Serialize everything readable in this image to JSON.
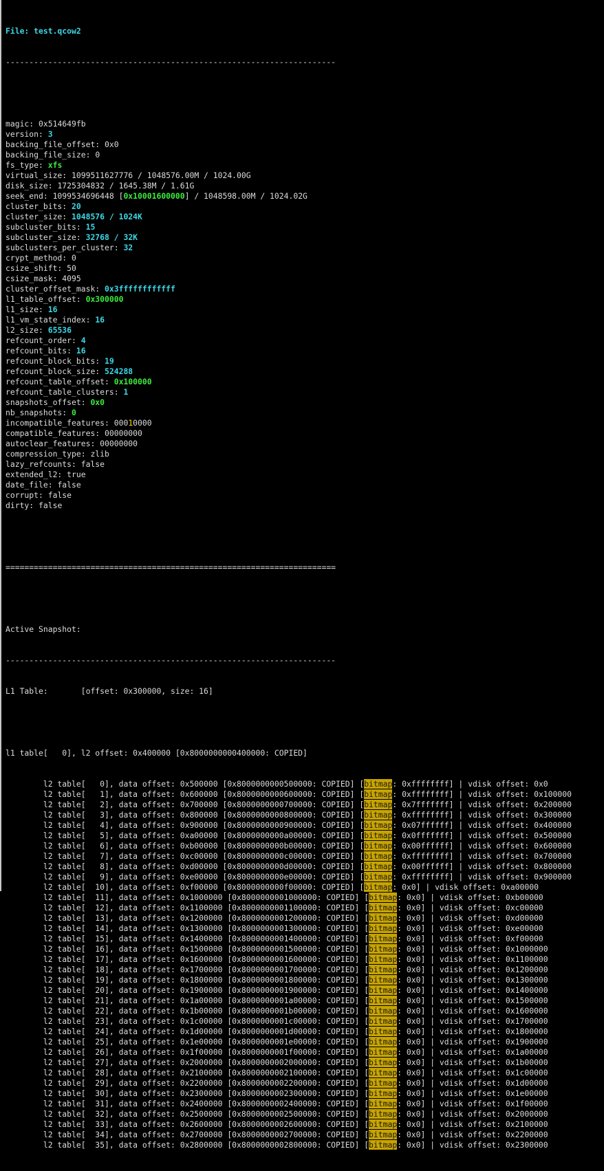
{
  "file_line": "File: test.qcow2",
  "separator_dash": "----------------------------------------------------------------------",
  "separator_eq": "======================================================================",
  "header_fields": [
    {
      "key": "magic",
      "value": "0x514649fb",
      "style": ""
    },
    {
      "key": "version",
      "value": "3",
      "style": "cyan"
    },
    {
      "key": "backing_file_offset",
      "value": "0x0",
      "style": ""
    },
    {
      "key": "backing_file_size",
      "value": "0",
      "style": ""
    },
    {
      "key": "fs_type",
      "value": "xfs",
      "style": "green"
    },
    {
      "key": "virtual_size",
      "value": "1099511627776 / 1048576.00M / 1024.00G",
      "style": ""
    },
    {
      "key": "disk_size",
      "value": "1725304832 / 1645.38M / 1.61G",
      "style": ""
    },
    {
      "key": "seek_end",
      "value": "1099534696448 [0x10001600000] / 1048598.00M / 1024.02G",
      "style": "seek"
    },
    {
      "key": "cluster_bits",
      "value": "20",
      "style": "cyan"
    },
    {
      "key": "cluster_size",
      "value": "1048576 / 1024K",
      "style": "cyan"
    },
    {
      "key": "subcluster_bits",
      "value": "15",
      "style": "cyan"
    },
    {
      "key": "subcluster_size",
      "value": "32768 / 32K",
      "style": "cyan"
    },
    {
      "key": "subclusters_per_cluster",
      "value": "32",
      "style": "cyan"
    },
    {
      "key": "crypt_method",
      "value": "0",
      "style": ""
    },
    {
      "key": "csize_shift",
      "value": "50",
      "style": ""
    },
    {
      "key": "csize_mask",
      "value": "4095",
      "style": ""
    },
    {
      "key": "cluster_offset_mask",
      "value": "0x3ffffffffffff",
      "style": "cyan"
    },
    {
      "key": "l1_table_offset",
      "value": "0x300000",
      "style": "green"
    },
    {
      "key": "l1_size",
      "value": "16",
      "style": "cyan"
    },
    {
      "key": "l1_vm_state_index",
      "value": "16",
      "style": "cyan"
    },
    {
      "key": "l2_size",
      "value": "65536",
      "style": "cyan"
    },
    {
      "key": "refcount_order",
      "value": "4",
      "style": "cyan"
    },
    {
      "key": "refcount_bits",
      "value": "16",
      "style": "cyan"
    },
    {
      "key": "refcount_block_bits",
      "value": "19",
      "style": "cyan"
    },
    {
      "key": "refcount_block_size",
      "value": "524288",
      "style": "cyan"
    },
    {
      "key": "refcount_table_offset",
      "value": "0x100000",
      "style": "green"
    },
    {
      "key": "refcount_table_clusters",
      "value": "1",
      "style": "cyan"
    },
    {
      "key": "snapshots_offset",
      "value": "0x0",
      "style": "green"
    },
    {
      "key": "nb_snapshots",
      "value": "0",
      "style": "green"
    },
    {
      "key": "incompatible_features",
      "value": "00010000",
      "style": "incompat"
    },
    {
      "key": "compatible_features",
      "value": "00000000",
      "style": ""
    },
    {
      "key": "autoclear_features",
      "value": "00000000",
      "style": ""
    },
    {
      "key": "compression_type",
      "value": "zlib",
      "style": ""
    },
    {
      "key": "lazy_refcounts",
      "value": "false",
      "style": ""
    },
    {
      "key": "extended_l2",
      "value": "true",
      "style": ""
    },
    {
      "key": "date_file",
      "value": "false",
      "style": ""
    },
    {
      "key": "corrupt",
      "value": "false",
      "style": ""
    },
    {
      "key": "dirty",
      "value": "false",
      "style": ""
    }
  ],
  "active_snapshot_label": "Active Snapshot:",
  "l1_table_line": "L1 Table:       [offset: 0x300000, size: 16]",
  "l1_entry_line": "l1 table[   0], l2 offset: 0x400000 [0x8000000000400000: COPIED]",
  "l2_entries": [
    {
      "idx": "0",
      "data": "0x500000",
      "raw": "0x8000000000500000",
      "bitmap": "0xffffffff",
      "vdisk": "0x0"
    },
    {
      "idx": "1",
      "data": "0x600000",
      "raw": "0x8000000000600000",
      "bitmap": "0xffffffff",
      "vdisk": "0x100000"
    },
    {
      "idx": "2",
      "data": "0x700000",
      "raw": "0x8000000000700000",
      "bitmap": "0x7fffffff",
      "vdisk": "0x200000"
    },
    {
      "idx": "3",
      "data": "0x800000",
      "raw": "0x8000000000800000",
      "bitmap": "0xffffffff",
      "vdisk": "0x300000"
    },
    {
      "idx": "4",
      "data": "0x900000",
      "raw": "0x8000000000900000",
      "bitmap": "0x07ffffff",
      "vdisk": "0x400000"
    },
    {
      "idx": "5",
      "data": "0xa00000",
      "raw": "0x8000000000a00000",
      "bitmap": "0x0fffffff",
      "vdisk": "0x500000"
    },
    {
      "idx": "6",
      "data": "0xb00000",
      "raw": "0x8000000000b00000",
      "bitmap": "0x00ffffff",
      "vdisk": "0x600000"
    },
    {
      "idx": "7",
      "data": "0xc00000",
      "raw": "0x8000000000c00000",
      "bitmap": "0xffffffff",
      "vdisk": "0x700000"
    },
    {
      "idx": "8",
      "data": "0xd00000",
      "raw": "0x8000000000d00000",
      "bitmap": "0x00ffffff",
      "vdisk": "0x800000"
    },
    {
      "idx": "9",
      "data": "0xe00000",
      "raw": "0x8000000000e00000",
      "bitmap": "0xffffffff",
      "vdisk": "0x900000"
    },
    {
      "idx": "10",
      "data": "0xf00000",
      "raw": "0x8000000000f00000",
      "bitmap": "0x0",
      "vdisk": "0xa00000"
    },
    {
      "idx": "11",
      "data": "0x1000000",
      "raw": "0x8000000001000000",
      "bitmap": "0x0",
      "vdisk": "0xb00000"
    },
    {
      "idx": "12",
      "data": "0x1100000",
      "raw": "0x8000000001100000",
      "bitmap": "0x0",
      "vdisk": "0xc00000"
    },
    {
      "idx": "13",
      "data": "0x1200000",
      "raw": "0x8000000001200000",
      "bitmap": "0x0",
      "vdisk": "0xd00000"
    },
    {
      "idx": "14",
      "data": "0x1300000",
      "raw": "0x8000000001300000",
      "bitmap": "0x0",
      "vdisk": "0xe00000"
    },
    {
      "idx": "15",
      "data": "0x1400000",
      "raw": "0x8000000001400000",
      "bitmap": "0x0",
      "vdisk": "0xf00000"
    },
    {
      "idx": "16",
      "data": "0x1500000",
      "raw": "0x8000000001500000",
      "bitmap": "0x0",
      "vdisk": "0x1000000"
    },
    {
      "idx": "17",
      "data": "0x1600000",
      "raw": "0x8000000001600000",
      "bitmap": "0x0",
      "vdisk": "0x1100000"
    },
    {
      "idx": "18",
      "data": "0x1700000",
      "raw": "0x8000000001700000",
      "bitmap": "0x0",
      "vdisk": "0x1200000"
    },
    {
      "idx": "19",
      "data": "0x1800000",
      "raw": "0x8000000001800000",
      "bitmap": "0x0",
      "vdisk": "0x1300000"
    },
    {
      "idx": "20",
      "data": "0x1900000",
      "raw": "0x8000000001900000",
      "bitmap": "0x0",
      "vdisk": "0x1400000"
    },
    {
      "idx": "21",
      "data": "0x1a00000",
      "raw": "0x8000000001a00000",
      "bitmap": "0x0",
      "vdisk": "0x1500000"
    },
    {
      "idx": "22",
      "data": "0x1b00000",
      "raw": "0x8000000001b00000",
      "bitmap": "0x0",
      "vdisk": "0x1600000"
    },
    {
      "idx": "23",
      "data": "0x1c00000",
      "raw": "0x8000000001c00000",
      "bitmap": "0x0",
      "vdisk": "0x1700000"
    },
    {
      "idx": "24",
      "data": "0x1d00000",
      "raw": "0x8000000001d00000",
      "bitmap": "0x0",
      "vdisk": "0x1800000"
    },
    {
      "idx": "25",
      "data": "0x1e00000",
      "raw": "0x8000000001e00000",
      "bitmap": "0x0",
      "vdisk": "0x1900000"
    },
    {
      "idx": "26",
      "data": "0x1f00000",
      "raw": "0x8000000001f00000",
      "bitmap": "0x0",
      "vdisk": "0x1a00000"
    },
    {
      "idx": "27",
      "data": "0x2000000",
      "raw": "0x8000000002000000",
      "bitmap": "0x0",
      "vdisk": "0x1b00000"
    },
    {
      "idx": "28",
      "data": "0x2100000",
      "raw": "0x8000000002100000",
      "bitmap": "0x0",
      "vdisk": "0x1c00000"
    },
    {
      "idx": "29",
      "data": "0x2200000",
      "raw": "0x8000000002200000",
      "bitmap": "0x0",
      "vdisk": "0x1d00000"
    },
    {
      "idx": "30",
      "data": "0x2300000",
      "raw": "0x8000000002300000",
      "bitmap": "0x0",
      "vdisk": "0x1e00000"
    },
    {
      "idx": "31",
      "data": "0x2400000",
      "raw": "0x8000000002400000",
      "bitmap": "0x0",
      "vdisk": "0x1f00000"
    },
    {
      "idx": "32",
      "data": "0x2500000",
      "raw": "0x8000000002500000",
      "bitmap": "0x0",
      "vdisk": "0x2000000"
    },
    {
      "idx": "33",
      "data": "0x2600000",
      "raw": "0x8000000002600000",
      "bitmap": "0x0",
      "vdisk": "0x2100000"
    },
    {
      "idx": "34",
      "data": "0x2700000",
      "raw": "0x8000000002700000",
      "bitmap": "0x0",
      "vdisk": "0x2200000"
    },
    {
      "idx": "35",
      "data": "0x2800000",
      "raw": "0x8000000002800000",
      "bitmap": "0x0",
      "vdisk": "0x2300000"
    }
  ],
  "colors": {
    "background": "#000000",
    "text": "#dcdcdc",
    "cyan": "#3cd8e6",
    "green": "#3cec3c",
    "bitmap_highlight": "#c8a400"
  }
}
